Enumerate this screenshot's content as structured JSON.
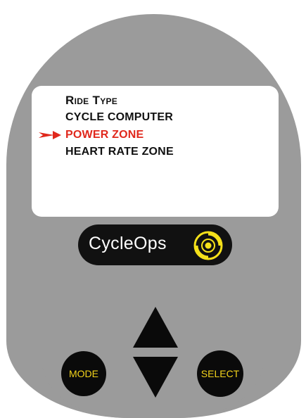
{
  "screen": {
    "title": "Ride Type",
    "items": [
      {
        "label": "CYCLE COMPUTER",
        "selected": false
      },
      {
        "label": "POWER ZONE",
        "selected": true
      },
      {
        "label": "HEART RATE ZONE",
        "selected": false
      }
    ]
  },
  "brand": {
    "name": "CycleOps"
  },
  "buttons": {
    "mode_label": "MODE",
    "select_label": "SELECT"
  },
  "colors": {
    "device_body": "#9b9b9b",
    "screen_bg": "#ffffff",
    "selected_text": "#e0281c",
    "button_text": "#f2d21a",
    "logo_accent": "#f5e11a"
  },
  "icons": {
    "pointer": "arrow-right-icon",
    "up": "triangle-up-icon",
    "down": "triangle-down-icon",
    "logo_mark": "cycleops-swirl-icon"
  }
}
